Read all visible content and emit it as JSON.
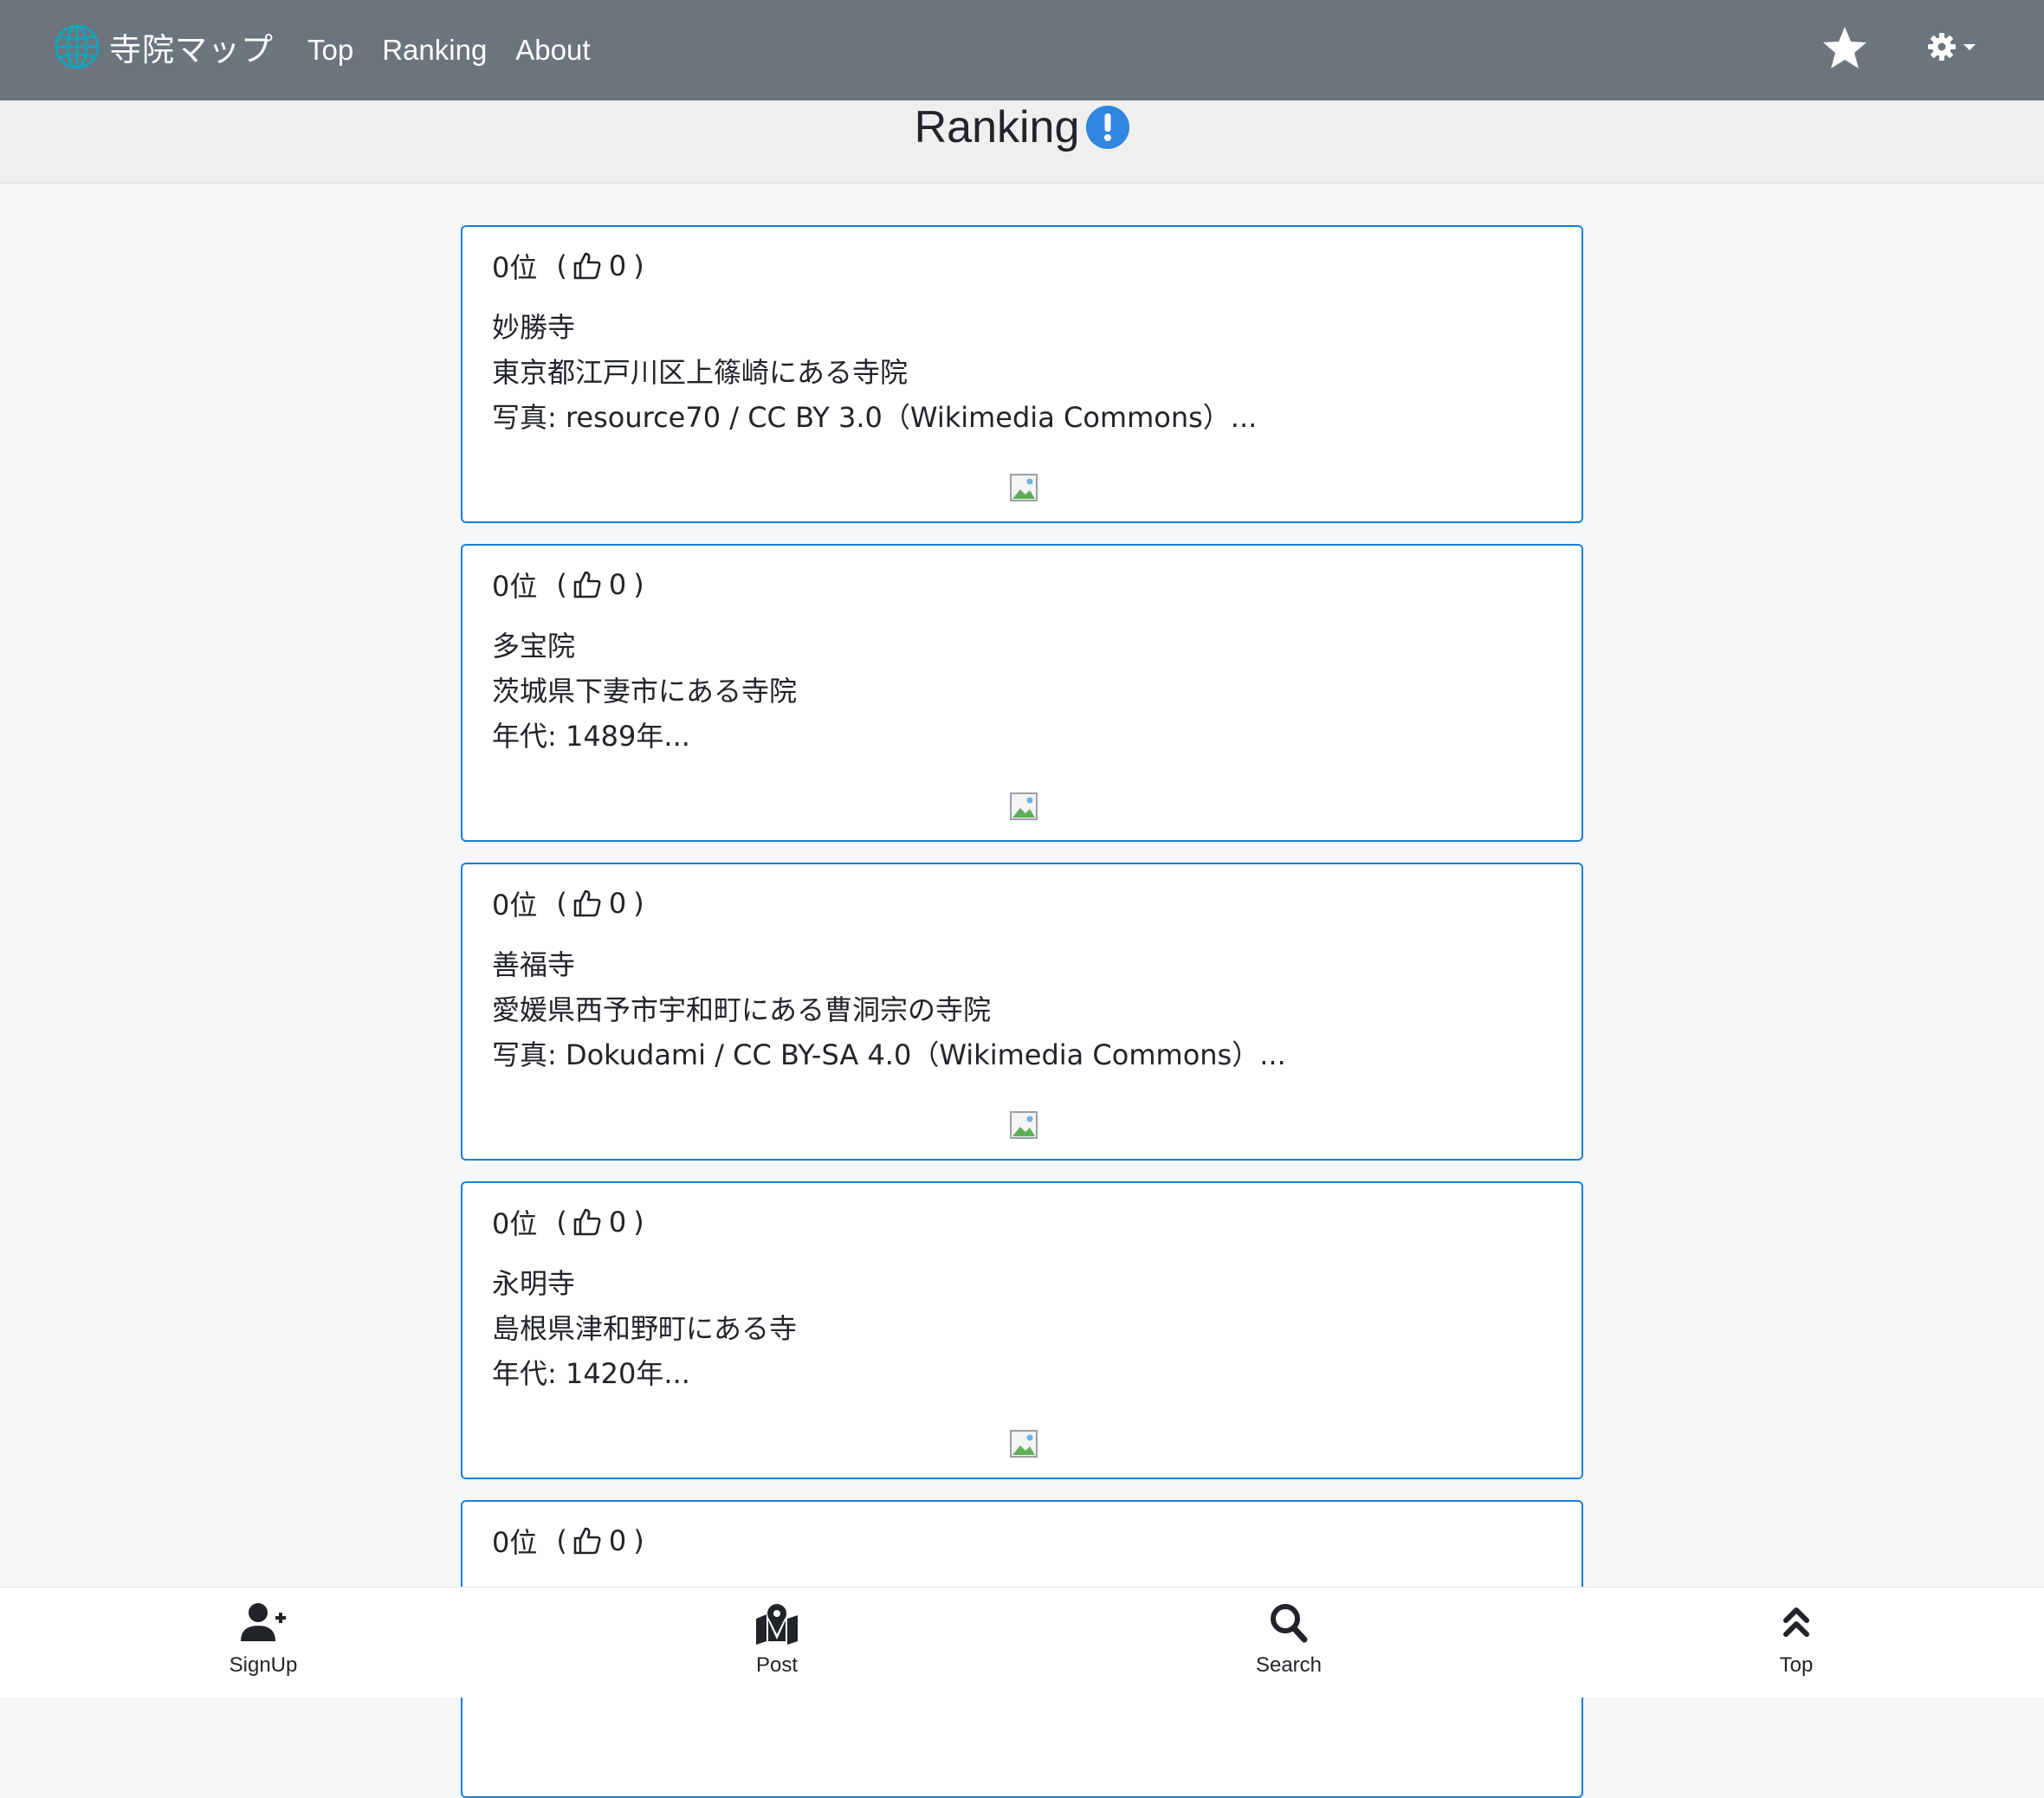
{
  "navbar": {
    "brand": "寺院マップ",
    "links": [
      "Top",
      "Ranking",
      "About"
    ]
  },
  "page": {
    "title": "Ranking"
  },
  "cards": [
    {
      "rank": "0位",
      "open_paren": "(",
      "likes": "0",
      "close_paren": ")",
      "lines": [
        "妙勝寺",
        "東京都江戸川区上篠崎にある寺院",
        "写真: resource70 / CC BY 3.0（Wikimedia Commons）..."
      ]
    },
    {
      "rank": "0位",
      "open_paren": "(",
      "likes": "0",
      "close_paren": ")",
      "lines": [
        "多宝院",
        "茨城県下妻市にある寺院",
        "年代: 1489年..."
      ]
    },
    {
      "rank": "0位",
      "open_paren": "(",
      "likes": "0",
      "close_paren": ")",
      "lines": [
        "善福寺",
        "愛媛県西予市宇和町にある曹洞宗の寺院",
        "写真: Dokudami / CC BY-SA 4.0（Wikimedia Commons）..."
      ]
    },
    {
      "rank": "0位",
      "open_paren": "(",
      "likes": "0",
      "close_paren": ")",
      "lines": [
        "永明寺",
        "島根県津和野町にある寺",
        "年代: 1420年..."
      ]
    },
    {
      "rank": "0位",
      "open_paren": "(",
      "likes": "0",
      "close_paren": ")",
      "lines": [
        "",
        "",
        ""
      ]
    }
  ],
  "bottom_nav": [
    {
      "label": "SignUp",
      "icon": "user-plus-icon"
    },
    {
      "label": "Post",
      "icon": "map-marker-icon"
    },
    {
      "label": "Search",
      "icon": "search-icon"
    },
    {
      "label": "Top",
      "icon": "double-chevron-up-icon"
    }
  ],
  "colors": {
    "navbar": "#6c757d",
    "card_border": "#1b7fd4",
    "info_icon": "#2e86de",
    "globe_icon": "#17a2b8"
  }
}
